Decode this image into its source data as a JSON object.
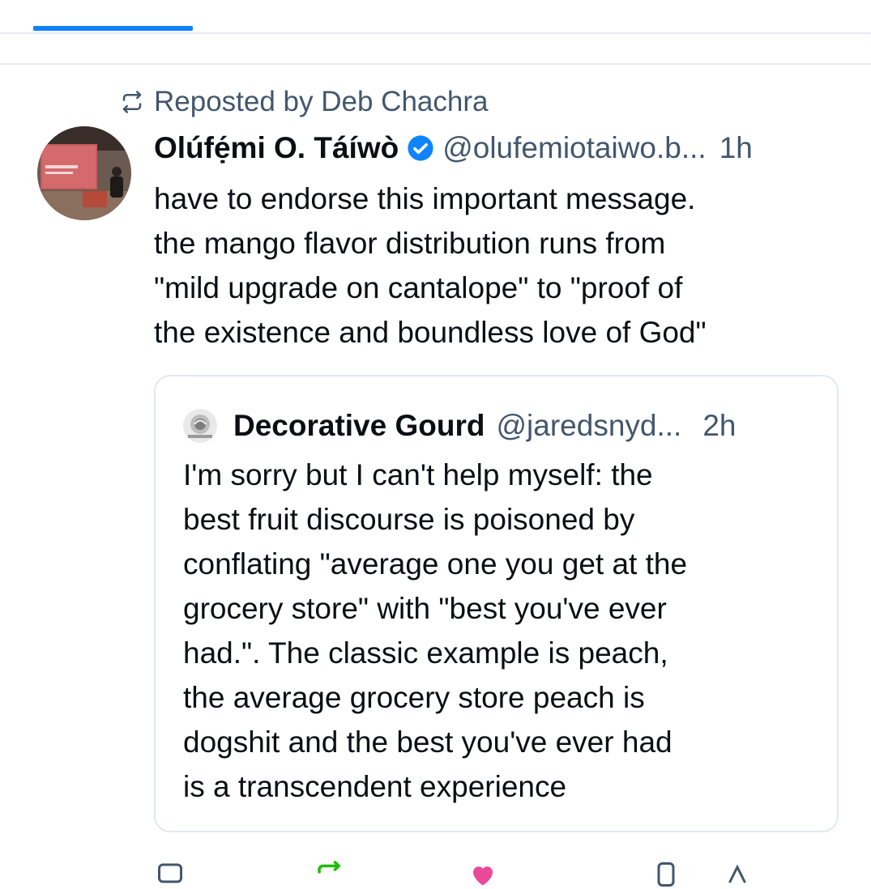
{
  "repost": {
    "label": "Reposted by Deb Chachra",
    "icon": "repost-icon"
  },
  "post": {
    "author_name": "Olúfẹ́mi O. Táíwò",
    "handle": "@olufemiotaiwo.b...",
    "time": "1h",
    "verified_color": "#1083fe",
    "text_lines": [
      "have to endorse this important message.",
      "the mango flavor distribution runs from",
      "\"mild upgrade on cantalope\" to \"proof of",
      "the existence and boundless love of God\""
    ]
  },
  "quote": {
    "author_name": "Decorative Gourd",
    "handle": "@jaredsnyd...",
    "time": "2h",
    "text_lines": [
      "I'm sorry but I can't help myself: the",
      "best fruit discourse is poisoned by",
      "conflating \"average one you get at the",
      "grocery store\" with \"best you've ever",
      "had.\". The classic example is peach,",
      "the average grocery store peach is",
      "dogshit and the best you've ever had",
      "is a transcendent experience"
    ]
  },
  "actions": {
    "reply_icon": "reply-icon",
    "repost_icon": "repost-icon",
    "like_icon": "heart-icon",
    "bookmark_icon": "bookmark-icon",
    "share_icon": "share-icon"
  },
  "colors": {
    "accent": "#1083fe",
    "muted": "#42576c",
    "like": "#ec4899",
    "repost": "#20bc07"
  }
}
